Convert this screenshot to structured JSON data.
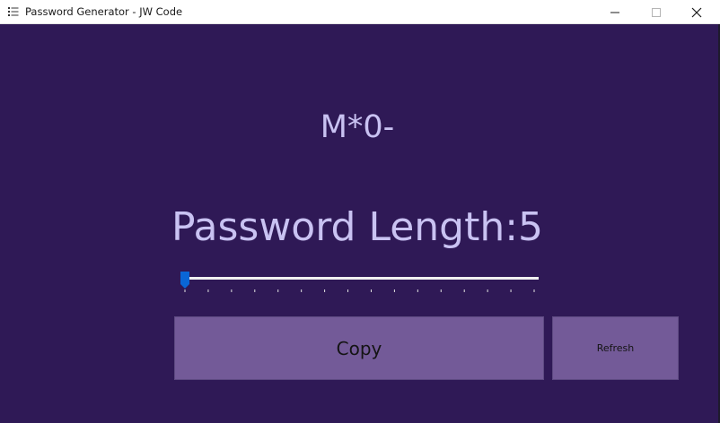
{
  "window": {
    "title": "Password Generator - JW Code",
    "controls": [
      "minimize-icon",
      "maximize-icon",
      "close-icon"
    ]
  },
  "app_icon": "list-icon",
  "password": {
    "value": "M*0-"
  },
  "length": {
    "label": "Password Length:5",
    "value": 5
  },
  "slider": {
    "value": 5,
    "tick_count": 16,
    "thumb_color": "#0a66d6",
    "track_color": "#f0f0f0",
    "tick_color": "#e0e0e0"
  },
  "buttons": {
    "copy_label": "Copy",
    "refresh_label": "Refresh"
  },
  "colors": {
    "background": "#2f1956",
    "text": "#c9c2f2",
    "button": "#735a98"
  }
}
